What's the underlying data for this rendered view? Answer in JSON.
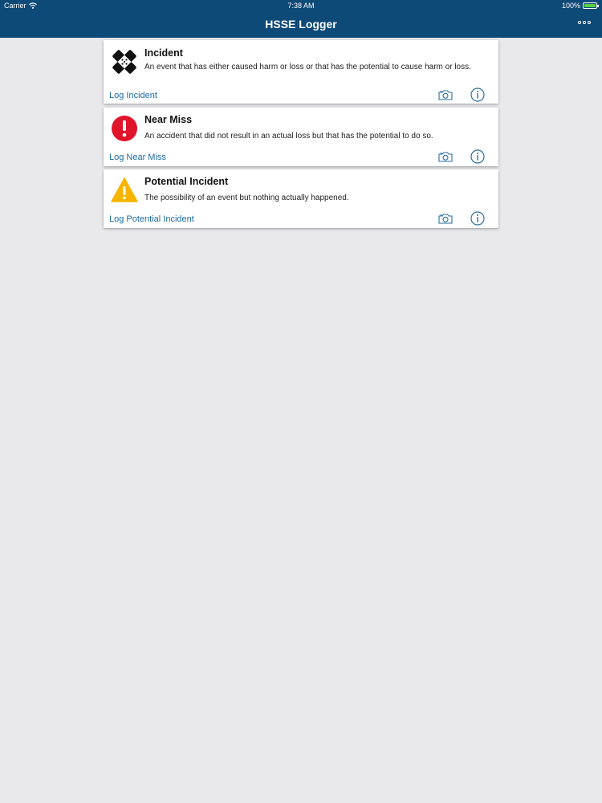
{
  "status_bar": {
    "carrier": "Carrier",
    "time": "7:38 AM",
    "battery": "100%",
    "battery_level": 1.0
  },
  "nav": {
    "title": "HSSE Logger",
    "more_icon": "more-dots-icon"
  },
  "colors": {
    "header": "#0d4a78",
    "link": "#1a6aa7",
    "near_miss_red": "#e0142a",
    "warning_yellow": "#f7b500"
  },
  "cards": [
    {
      "icon": "bandage-icon",
      "title": "Incident",
      "description": "An event that has either caused harm or loss or that has the potential to cause harm or loss.",
      "action": "Log Incident"
    },
    {
      "icon": "exclamation-circle-icon",
      "title": "Near Miss",
      "description": "An accident that did not result in an actual loss but that has the potential to do so.",
      "action": "Log Near Miss"
    },
    {
      "icon": "warning-triangle-icon",
      "title": "Potential Incident",
      "description": "The possibility of an event but nothing actually happened.",
      "action": "Log Potential Incident"
    }
  ]
}
